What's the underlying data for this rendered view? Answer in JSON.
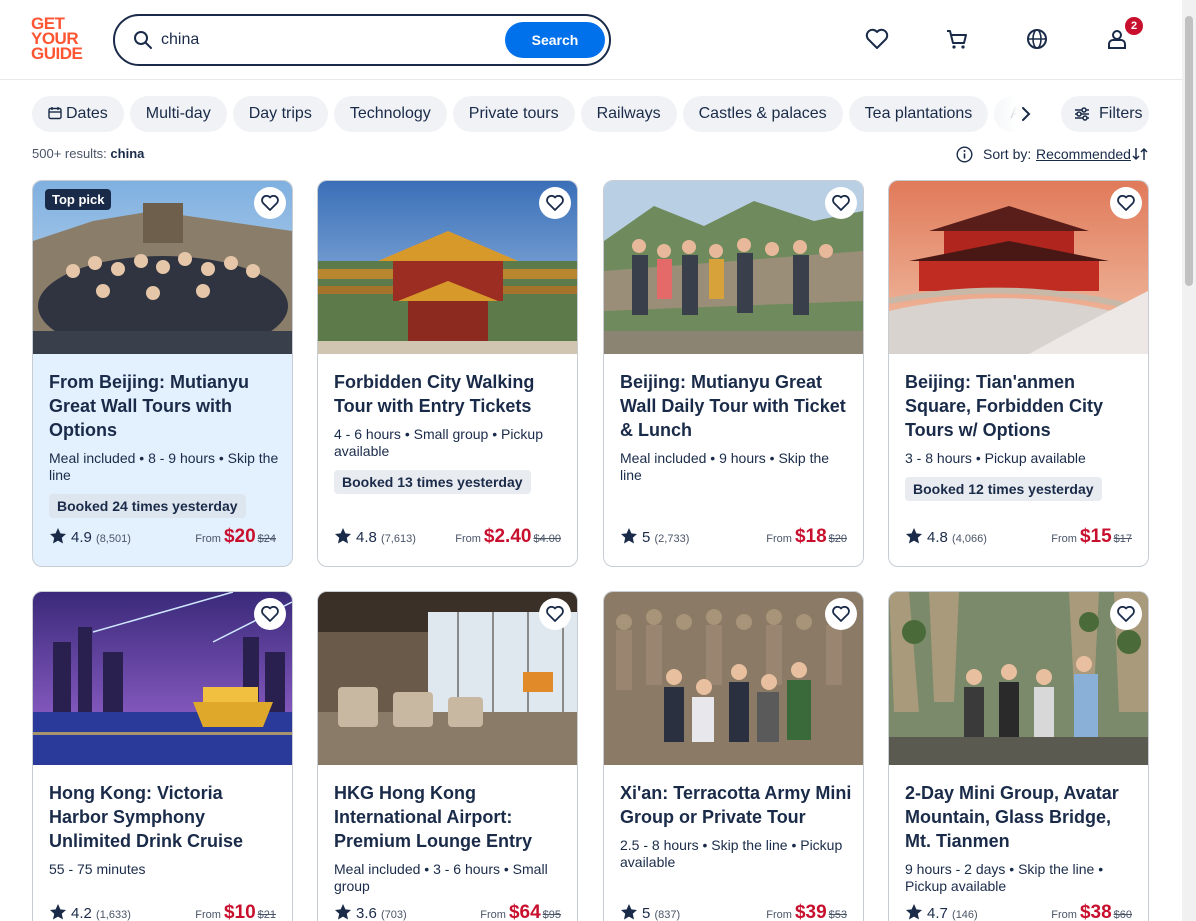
{
  "brand": {
    "line1": "GET",
    "line2": "YOUR",
    "line3": "GUIDE",
    "color": "#ff5533"
  },
  "search": {
    "value": "china",
    "button_label": "Search"
  },
  "header": {
    "cart_badge": "2"
  },
  "chips": [
    "Dates",
    "Multi-day",
    "Day trips",
    "Technology",
    "Private tours",
    "Railways",
    "Castles & palaces",
    "Tea plantations",
    "A"
  ],
  "filters_label": "Filters",
  "results": {
    "count": "500+ results:",
    "query": "china"
  },
  "sort": {
    "label": "Sort by:",
    "value": "Recommended"
  },
  "cards": [
    {
      "top_pick": "Top pick",
      "title": "From Beijing: Mutianyu Great Wall Tours with Options",
      "meta": "Meal included • 8 - 9 hours • Skip the line",
      "booked": "Booked 24 times yesterday",
      "rating": "4.9",
      "reviews": "(8,501)",
      "from": "From",
      "price": "$20",
      "was": "$24"
    },
    {
      "title": "Forbidden City Walking Tour with Entry Tickets",
      "meta": "4 - 6 hours • Small group • Pickup available",
      "booked": "Booked 13 times yesterday",
      "rating": "4.8",
      "reviews": "(7,613)",
      "from": "From",
      "price": "$2.40",
      "was": "$4.00"
    },
    {
      "title": "Beijing: Mutianyu Great Wall Daily Tour with Ticket & Lunch",
      "meta": "Meal included • 9 hours • Skip the line",
      "rating": "5",
      "reviews": "(2,733)",
      "from": "From",
      "price": "$18",
      "was": "$20"
    },
    {
      "title": "Beijing: Tian'anmen Square, Forbidden City Tours w/ Options",
      "meta": "3 - 8 hours • Pickup available",
      "booked": "Booked 12 times yesterday",
      "rating": "4.8",
      "reviews": "(4,066)",
      "from": "From",
      "price": "$15",
      "was": "$17"
    },
    {
      "title": "Hong Kong: Victoria Harbor Symphony Unlimited Drink Cruise",
      "meta": "55 - 75 minutes",
      "rating": "4.2",
      "reviews": "(1,633)",
      "from": "From",
      "price": "$10",
      "was": "$21"
    },
    {
      "title": "HKG Hong Kong International Airport: Premium Lounge Entry",
      "meta": "Meal included • 3 - 6 hours • Small group",
      "rating": "3.6",
      "reviews": "(703)",
      "from": "From",
      "price": "$64",
      "was": "$95"
    },
    {
      "title": "Xi'an: Terracotta Army Mini Group or Private Tour",
      "meta": "2.5 - 8 hours • Skip the line • Pickup available",
      "rating": "5",
      "reviews": "(837)",
      "from": "From",
      "price": "$39",
      "was": "$53"
    },
    {
      "title": "2-Day Mini Group, Avatar Mountain, Glass Bridge, Mt. Tianmen",
      "meta": "9 hours - 2 days • Skip the line • Pickup available",
      "rating": "4.7",
      "reviews": "(146)",
      "from": "From",
      "price": "$38",
      "was": "$60"
    }
  ]
}
